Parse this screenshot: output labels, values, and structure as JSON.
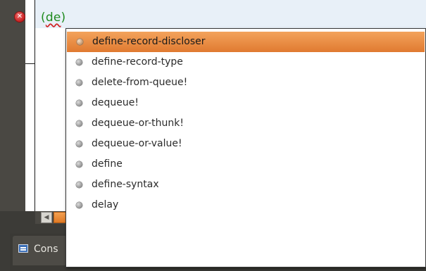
{
  "editor": {
    "current_line_prefix": "(",
    "current_line_partial": "de",
    "current_line_suffix": ")",
    "error_icon": "error-icon"
  },
  "popup": {
    "selected_index": 0,
    "items": [
      {
        "label": "define-record-discloser",
        "icon": "bullet-icon"
      },
      {
        "label": "define-record-type",
        "icon": "bullet-icon"
      },
      {
        "label": "delete-from-queue!",
        "icon": "bullet-icon"
      },
      {
        "label": "dequeue!",
        "icon": "bullet-icon"
      },
      {
        "label": "dequeue-or-thunk!",
        "icon": "bullet-icon"
      },
      {
        "label": "dequeue-or-value!",
        "icon": "bullet-icon"
      },
      {
        "label": "define",
        "icon": "bullet-icon"
      },
      {
        "label": "define-syntax",
        "icon": "bullet-icon"
      },
      {
        "label": "delay",
        "icon": "bullet-icon"
      }
    ]
  },
  "bottom_panel": {
    "console_tab_label": "Cons",
    "console_icon": "console-icon"
  },
  "colors": {
    "selection_accent": "#e88a3c",
    "code_text": "#1e8a1e",
    "error_red": "#c81e1e"
  }
}
